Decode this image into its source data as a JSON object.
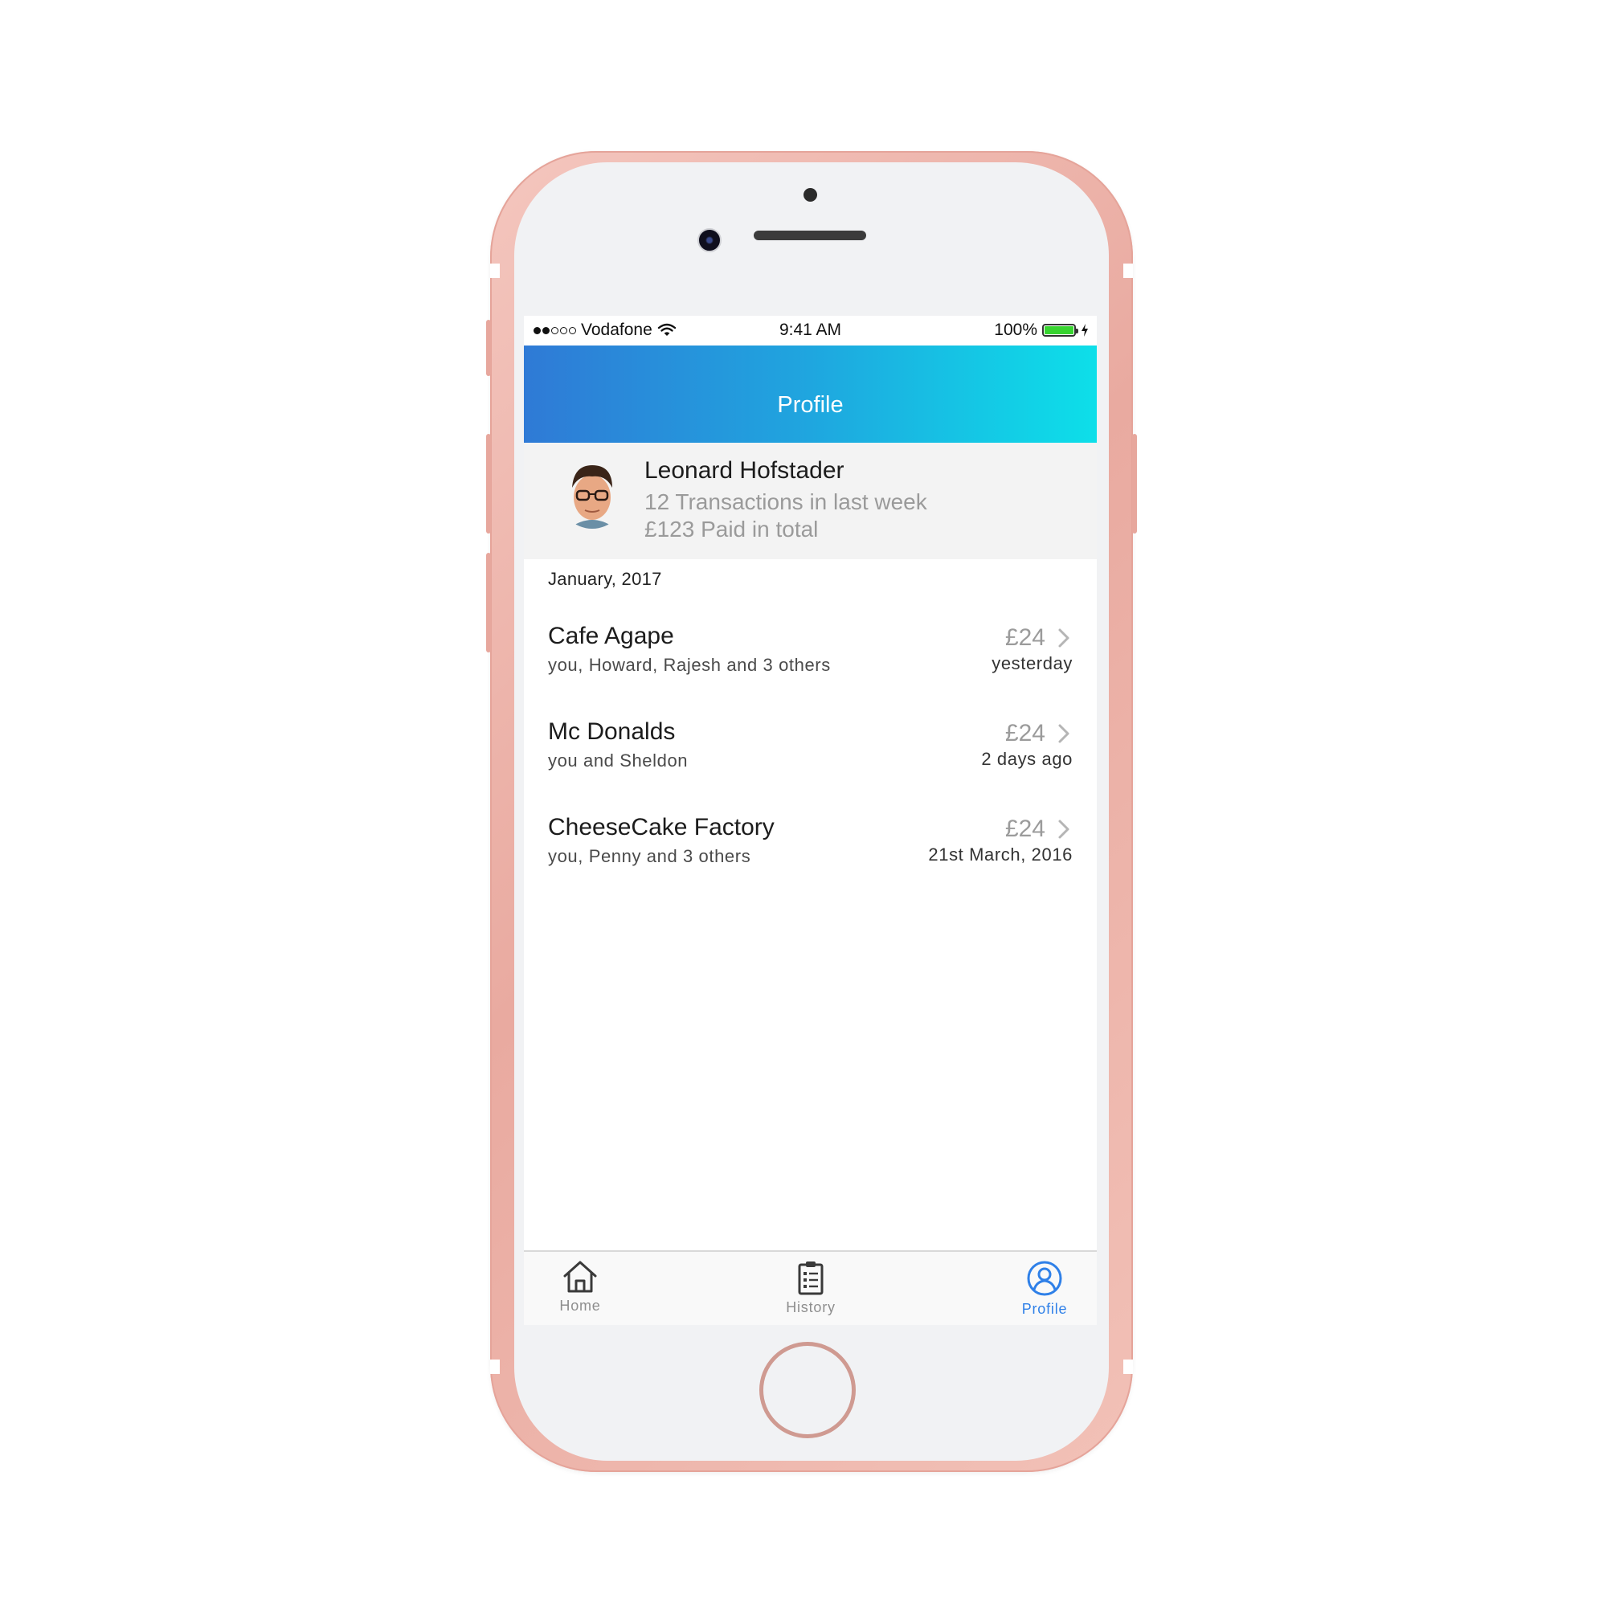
{
  "status_bar": {
    "carrier": "Vodafone",
    "time": "9:41 AM",
    "battery": "100%",
    "battery_level": 1.0,
    "icons": [
      "signal-dots-icon",
      "wifi-icon",
      "battery-icon",
      "charging-bolt-icon"
    ]
  },
  "nav": {
    "title": "Profile"
  },
  "profile": {
    "name": "Leonard Hofstader",
    "transactions": "12 Transactions in last week",
    "paid": "£123 Paid in total"
  },
  "section": {
    "header": "January, 2017"
  },
  "transactions": [
    {
      "title": "Cafe Agape",
      "people": "you, Howard, Rajesh and 3 others",
      "amount": "£24",
      "date": "yesterday"
    },
    {
      "title": "Mc Donalds",
      "people": "you and Sheldon",
      "amount": "£24",
      "date": "2 days ago"
    },
    {
      "title": "CheeseCake Factory",
      "people": "you, Penny and 3 others",
      "amount": "£24",
      "date": "21st March, 2016"
    }
  ],
  "tabs": [
    {
      "label": "Home",
      "icon": "home-icon",
      "active": false
    },
    {
      "label": "History",
      "icon": "clipboard-list-icon",
      "active": false
    },
    {
      "label": "Profile",
      "icon": "user-circle-icon",
      "active": true
    }
  ],
  "colors": {
    "nav_gradient_start": "#2f7ad6",
    "nav_gradient_end": "#0ddfe9",
    "tab_active": "#2f80e8",
    "tab_inactive": "#8e8e8e",
    "phone_frame": "#f0b8ae"
  }
}
